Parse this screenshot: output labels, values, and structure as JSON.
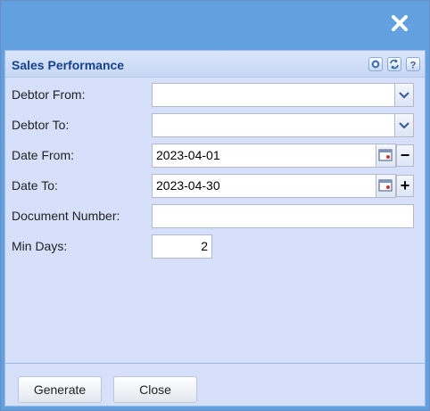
{
  "panel": {
    "title": "Sales Performance"
  },
  "form": {
    "debtor_from_label": "Debtor From:",
    "debtor_from_value": "",
    "debtor_to_label": "Debtor To:",
    "debtor_to_value": "",
    "date_from_label": "Date From:",
    "date_from_value": "2023-04-01",
    "date_to_label": "Date To:",
    "date_to_value": "2023-04-30",
    "document_number_label": "Document Number:",
    "document_number_value": "",
    "min_days_label": "Min Days:",
    "min_days_value": "2"
  },
  "buttons": {
    "generate": "Generate",
    "close": "Close",
    "minus": "−",
    "plus": "+"
  },
  "icons": {
    "close": "close-icon",
    "gear": "gear-icon",
    "refresh": "refresh-icon",
    "help": "help-icon",
    "dropdown": "chevron-down-icon",
    "calendar": "calendar-icon"
  },
  "colors": {
    "window_header": "#63a0e0",
    "panel_bg": "#d6e0fa",
    "title_text": "#15428b"
  }
}
